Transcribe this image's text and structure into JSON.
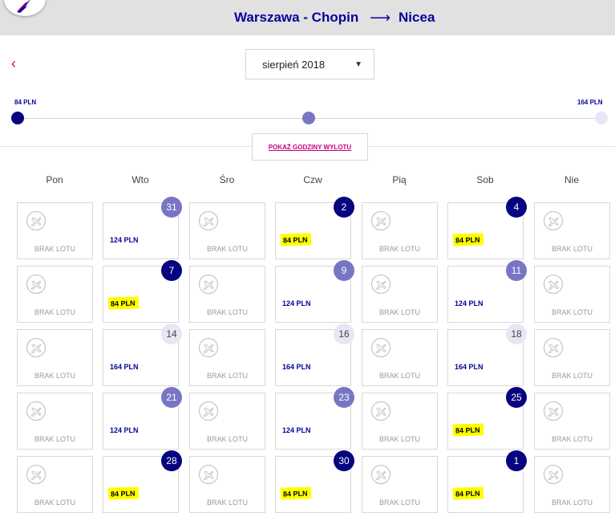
{
  "header": {
    "origin": "Warszawa - Chopin",
    "arrow": "⟶",
    "destination": "Nicea"
  },
  "icons": {
    "logo": "bird-logo-icon",
    "back": "chevron-left-icon",
    "caret": "caret-down-icon",
    "plane": "plane-icon"
  },
  "month": {
    "back_label": "‹",
    "selected": "sierpień 2018",
    "caret": "▼"
  },
  "price_scale": {
    "min_label": "84 PLN",
    "max_label": "164 PLN",
    "levels": [
      {
        "name": "low",
        "color": "#06047f"
      },
      {
        "name": "mid",
        "color": "#7876c4"
      },
      {
        "name": "high",
        "color": "#e6e6f4"
      }
    ]
  },
  "show_hours_label": "POKAŻ GODZINY WYLOTU",
  "no_flight_label": "BRAK LOTU",
  "weekdays": [
    "Pon",
    "Wto",
    "Śro",
    "Czw",
    "Pią",
    "Sob",
    "Nie"
  ],
  "weeks": [
    [
      {
        "day": null
      },
      {
        "day": "31",
        "price": "124 PLN",
        "level": "mid",
        "highlighted": false
      },
      {
        "day": null
      },
      {
        "day": "2",
        "price": "84 PLN",
        "level": "low",
        "highlighted": true
      },
      {
        "day": null
      },
      {
        "day": "4",
        "price": "84 PLN",
        "level": "low",
        "highlighted": true
      },
      {
        "day": null
      }
    ],
    [
      {
        "day": null
      },
      {
        "day": "7",
        "price": "84 PLN",
        "level": "low",
        "highlighted": true
      },
      {
        "day": null
      },
      {
        "day": "9",
        "price": "124 PLN",
        "level": "mid",
        "highlighted": false
      },
      {
        "day": null
      },
      {
        "day": "11",
        "price": "124 PLN",
        "level": "mid",
        "highlighted": false
      },
      {
        "day": null
      }
    ],
    [
      {
        "day": null
      },
      {
        "day": "14",
        "price": "164 PLN",
        "level": "high",
        "highlighted": false
      },
      {
        "day": null
      },
      {
        "day": "16",
        "price": "164 PLN",
        "level": "high",
        "highlighted": false
      },
      {
        "day": null
      },
      {
        "day": "18",
        "price": "164 PLN",
        "level": "high",
        "highlighted": false
      },
      {
        "day": null
      }
    ],
    [
      {
        "day": null
      },
      {
        "day": "21",
        "price": "124 PLN",
        "level": "mid",
        "highlighted": false
      },
      {
        "day": null
      },
      {
        "day": "23",
        "price": "124 PLN",
        "level": "mid",
        "highlighted": false
      },
      {
        "day": null
      },
      {
        "day": "25",
        "price": "84 PLN",
        "level": "low",
        "highlighted": true
      },
      {
        "day": null
      }
    ],
    [
      {
        "day": null
      },
      {
        "day": "28",
        "price": "84 PLN",
        "level": "low",
        "highlighted": true
      },
      {
        "day": null
      },
      {
        "day": "30",
        "price": "84 PLN",
        "level": "low",
        "highlighted": true
      },
      {
        "day": null
      },
      {
        "day": "1",
        "price": "84 PLN",
        "level": "low",
        "highlighted": true
      },
      {
        "day": null
      }
    ]
  ]
}
